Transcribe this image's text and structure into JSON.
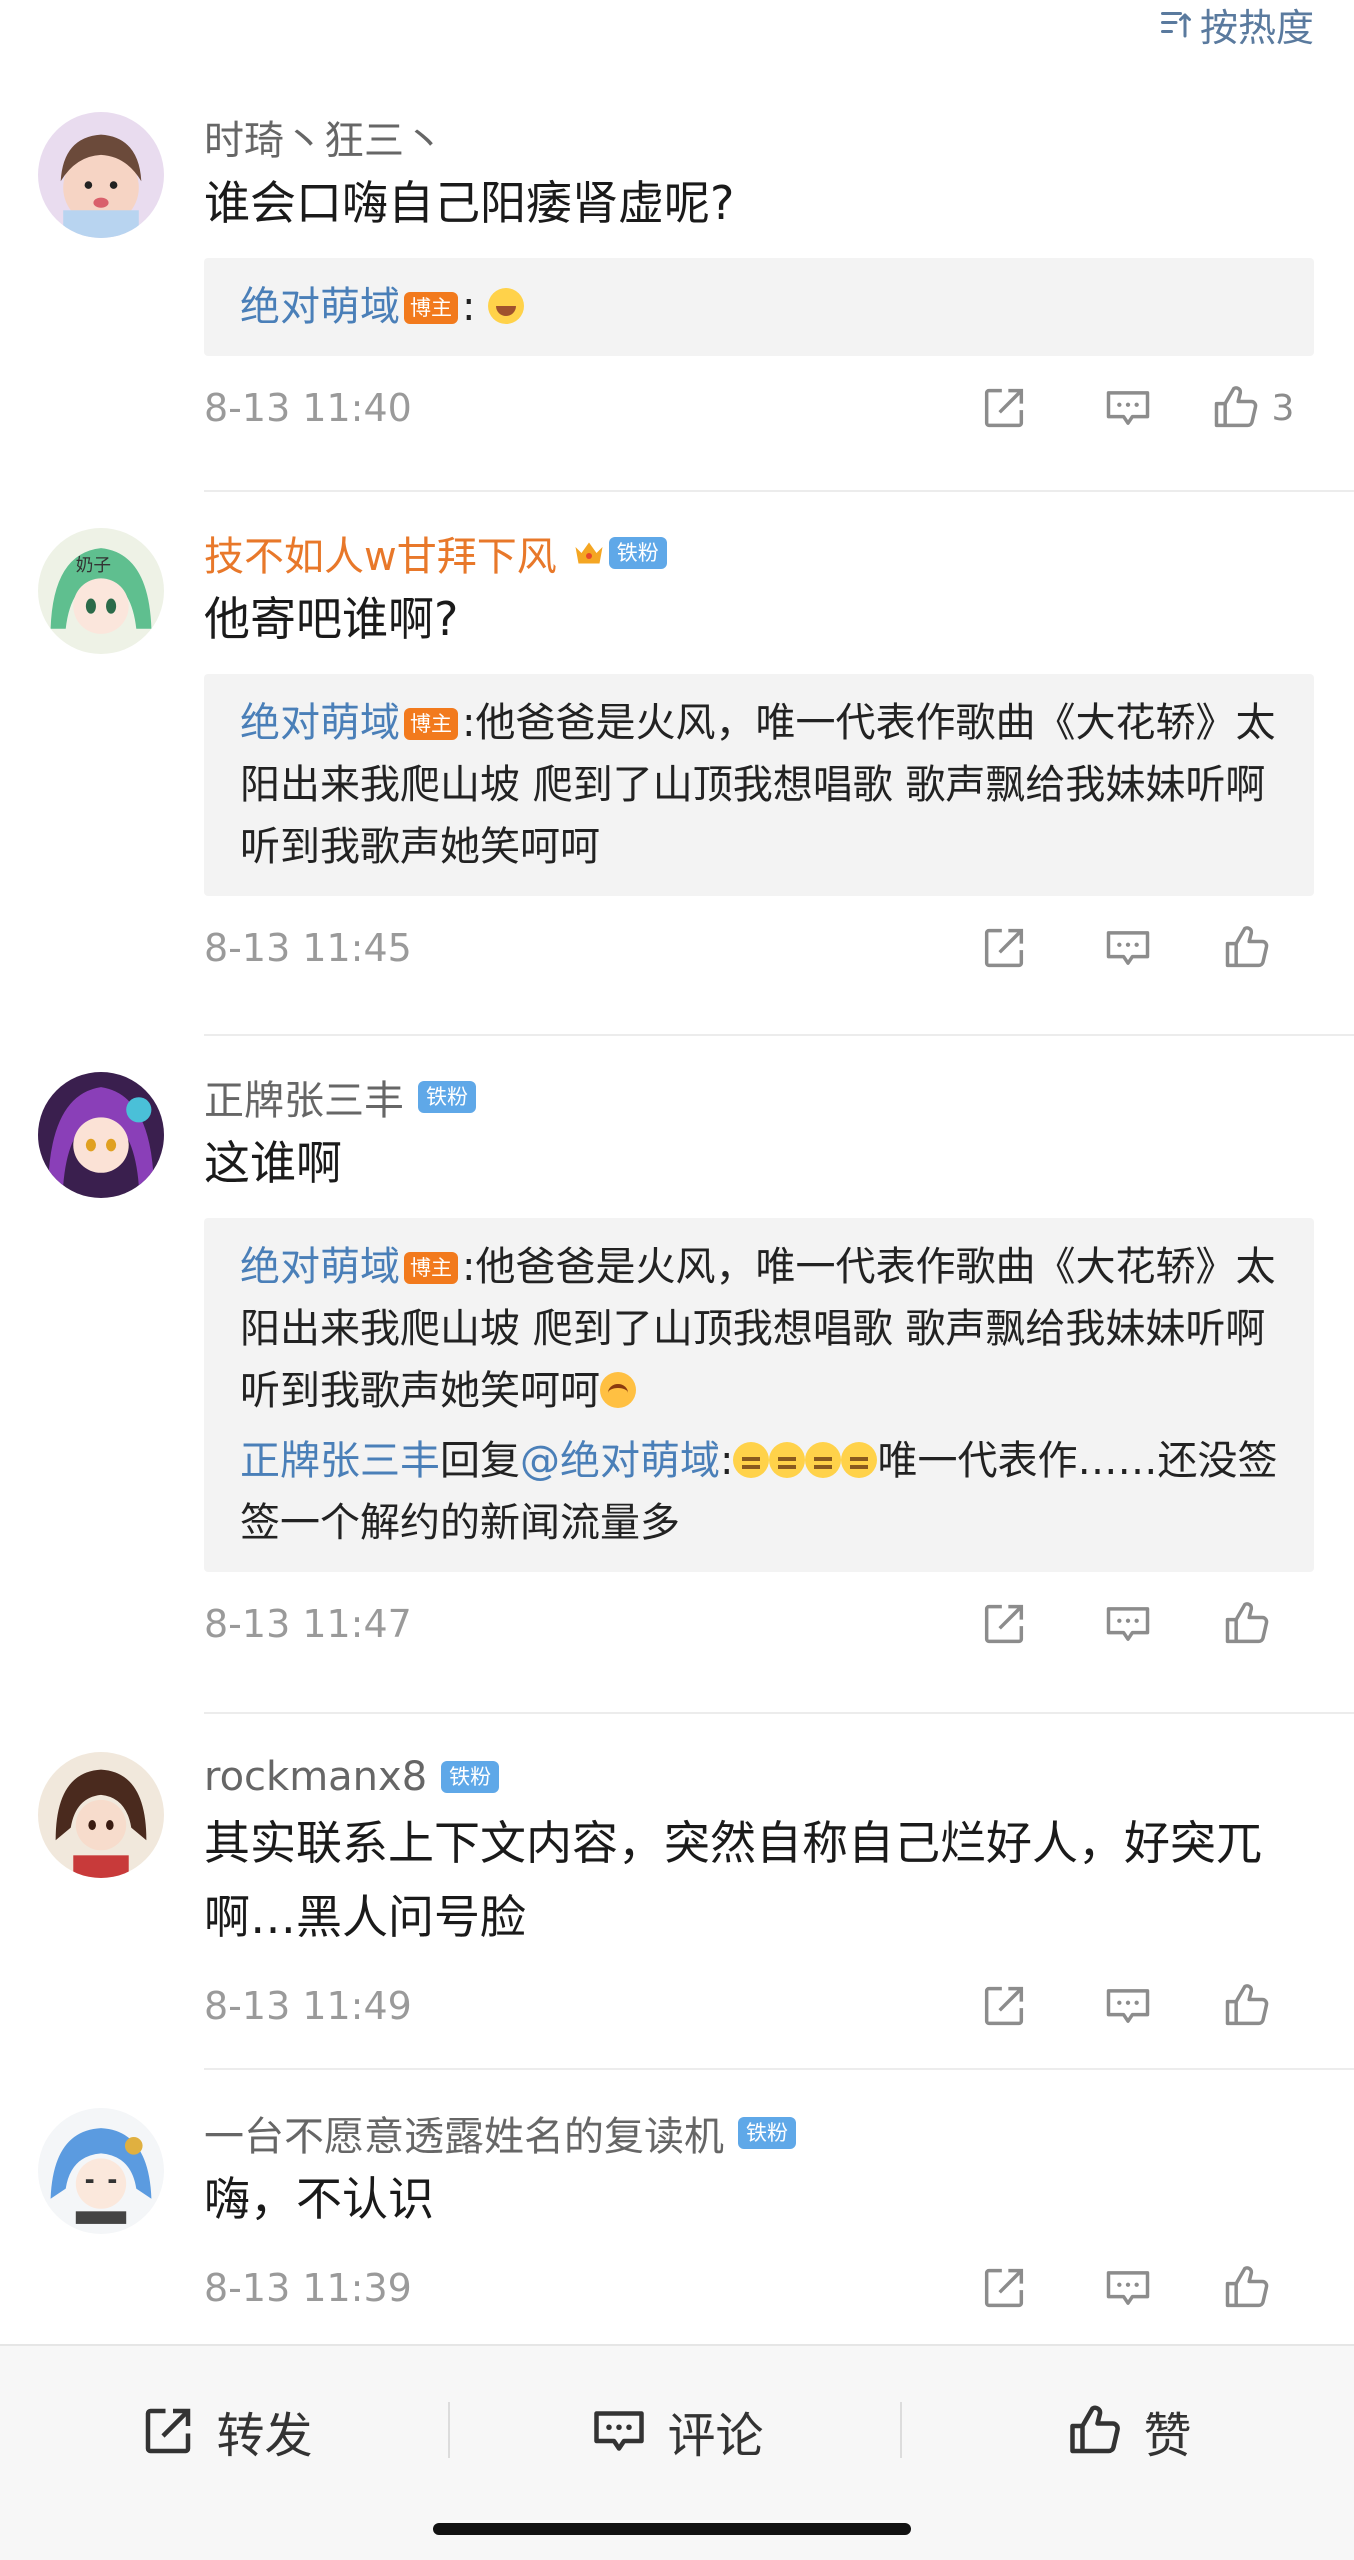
{
  "sort": {
    "label": "按热度",
    "icon": "sort-icon"
  },
  "comments": [
    {
      "name": "时琦丶狂三丶",
      "name_color": "#666666",
      "badge": "",
      "text": "谁会口嗨自己阳痿肾虚呢?",
      "replies": [
        {
          "author": "绝对萌域",
          "role": "博主",
          "text": ":"
        }
      ],
      "time": "8-13 11:40",
      "likes": "3",
      "avatar_icon": "girl-avatar"
    },
    {
      "name": "技不如人w甘拜下风",
      "name_color": "#e8782a",
      "badge": "铁粉",
      "text": "他寄吧谁啊?",
      "replies": [
        {
          "author": "绝对萌域",
          "role": "博主",
          "text": ":他爸爸是火风，唯一代表作歌曲《大花轿》太阳出来我爬山坡 爬到了山顶我想唱歌 歌声飘给我妹妹听啊 听到我歌声她笑呵呵"
        }
      ],
      "time": "8-13 11:45",
      "likes": "",
      "avatar_icon": "anime-green-hair-avatar"
    },
    {
      "name": "正牌张三丰",
      "name_color": "#666666",
      "badge": "铁粉",
      "text": "这谁啊",
      "replies": [
        {
          "author": "绝对萌域",
          "role": "博主",
          "text": ":他爸爸是火风，唯一代表作歌曲《大花轿》太阳出来我爬山坡 爬到了山顶我想唱歌 歌声飘给我妹妹听啊 听到我歌声她笑呵呵"
        },
        {
          "author": "正牌张三丰",
          "reply_word": "回复",
          "mention": "@绝对萌域",
          "text_after": ":",
          "text_tail": "唯一代表作……还没签签一个解约的新闻流量多"
        }
      ],
      "time": "8-13 11:47",
      "likes": "",
      "avatar_icon": "anime-purple-hair-avatar"
    },
    {
      "name": "rockmanx8",
      "name_color": "#666666",
      "badge": "铁粉",
      "text": "其实联系上下文内容，突然自称自己烂好人，好突兀啊…黑人问号脸",
      "replies": [],
      "time": "8-13 11:49",
      "likes": "",
      "avatar_icon": "anime-boy-avatar"
    },
    {
      "name": "一台不愿意透露姓名的复读机",
      "name_color": "#666666",
      "badge": "铁粉",
      "text": "嗨，不认识",
      "replies": [],
      "time": "8-13 11:39",
      "likes": "",
      "avatar_icon": "anime-blue-hair-avatar"
    }
  ],
  "bottom_bar": {
    "repost": "转发",
    "comment": "评论",
    "like": "赞"
  }
}
